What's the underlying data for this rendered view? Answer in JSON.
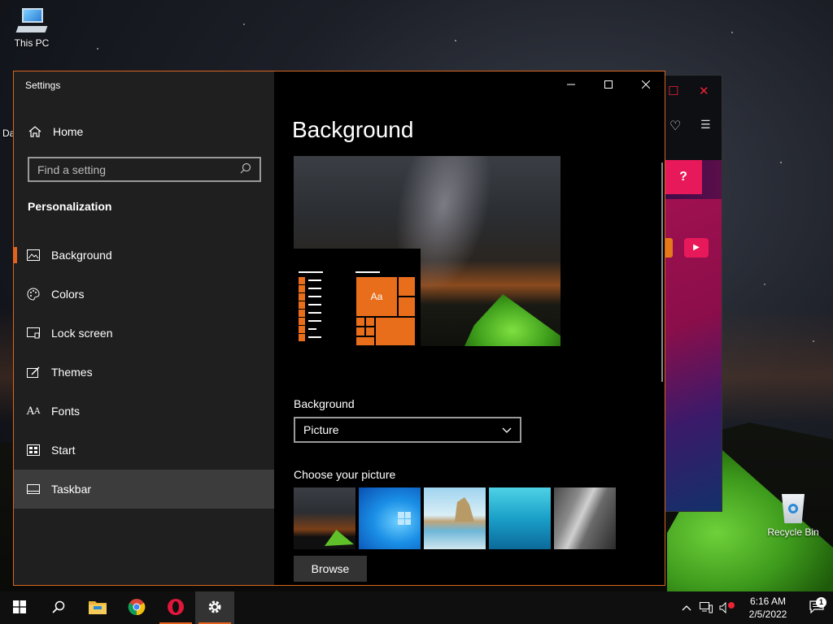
{
  "desktop": {
    "icons": [
      {
        "label": "This PC"
      },
      {
        "label": "Recycle Bin"
      }
    ],
    "partial_label": "Da"
  },
  "background_app": {
    "partial_button": "?"
  },
  "settings": {
    "window_title": "Settings",
    "home_label": "Home",
    "search_placeholder": "Find a setting",
    "section_title": "Personalization",
    "nav_items": [
      {
        "label": "Background",
        "icon": "image-icon"
      },
      {
        "label": "Colors",
        "icon": "palette-icon"
      },
      {
        "label": "Lock screen",
        "icon": "lock-screen-icon"
      },
      {
        "label": "Themes",
        "icon": "themes-icon"
      },
      {
        "label": "Fonts",
        "icon": "fonts-icon"
      },
      {
        "label": "Start",
        "icon": "start-icon"
      },
      {
        "label": "Taskbar",
        "icon": "taskbar-icon"
      }
    ],
    "page_title": "Background",
    "preview_tile_text": "Aa",
    "background_label": "Background",
    "background_value": "Picture",
    "choose_picture_label": "Choose your picture",
    "browse_label": "Browse",
    "accent_color": "#e4611c"
  },
  "taskbar": {
    "time": "6:16 AM",
    "date": "2/5/2022",
    "notification_count": "1"
  }
}
